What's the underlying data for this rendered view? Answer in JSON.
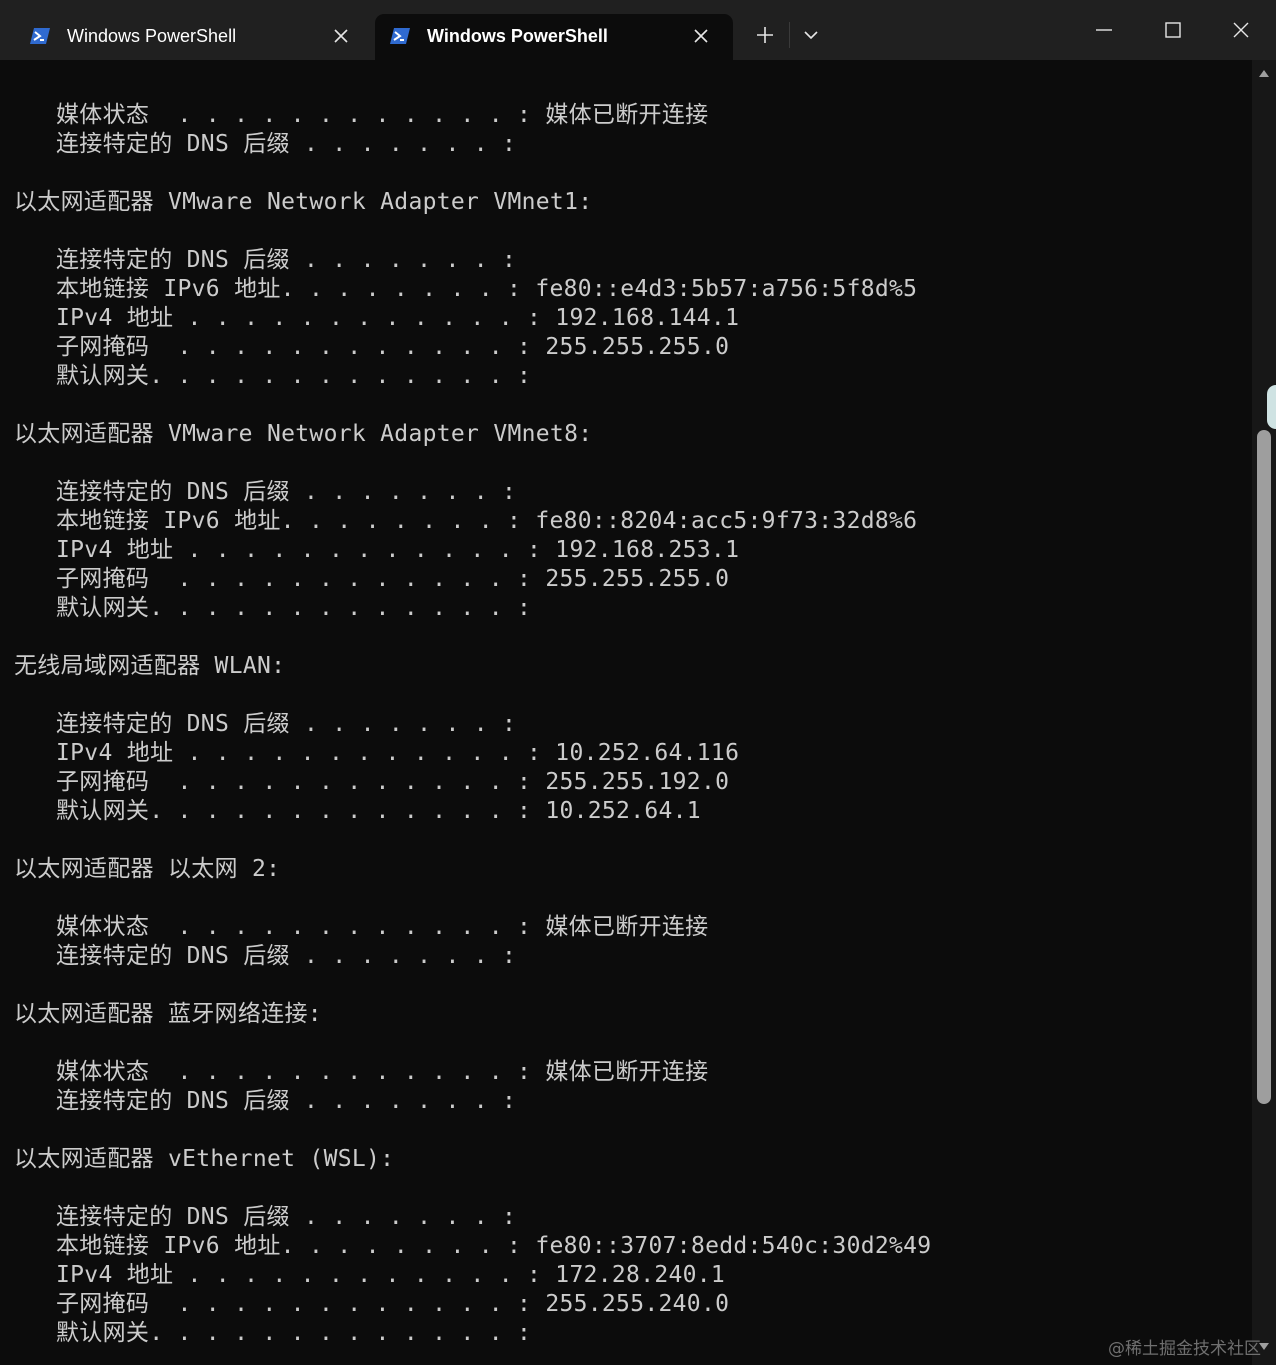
{
  "tabs": [
    {
      "title": "Windows PowerShell",
      "active": false
    },
    {
      "title": "Windows PowerShell",
      "active": true
    }
  ],
  "colors": {
    "titlebar": "#202020",
    "terminal_bg": "#0c0c0c",
    "text": "#cccccc",
    "powershell_icon": "#2f6ad0"
  },
  "terminal": {
    "lines": [
      "媒体状态  . . . . . . . . . . . . : 媒体已断开连接",
      "连接特定的 DNS 后缀 . . . . . . . :",
      "以太网适配器 VMware Network Adapter VMnet1:",
      "连接特定的 DNS 后缀 . . . . . . . :",
      "本地链接 IPv6 地址. . . . . . . . : fe80::e4d3:5b57:a756:5f8d%5",
      "IPv4 地址 . . . . . . . . . . . . : 192.168.144.1",
      "子网掩码  . . . . . . . . . . . . : 255.255.255.0",
      "默认网关. . . . . . . . . . . . . :",
      "以太网适配器 VMware Network Adapter VMnet8:",
      "连接特定的 DNS 后缀 . . . . . . . :",
      "本地链接 IPv6 地址. . . . . . . . : fe80::8204:acc5:9f73:32d8%6",
      "IPv4 地址 . . . . . . . . . . . . : 192.168.253.1",
      "子网掩码  . . . . . . . . . . . . : 255.255.255.0",
      "默认网关. . . . . . . . . . . . . :",
      "无线局域网适配器 WLAN:",
      "连接特定的 DNS 后缀 . . . . . . . :",
      "IPv4 地址 . . . . . . . . . . . . : 10.252.64.116",
      "子网掩码  . . . . . . . . . . . . : 255.255.192.0",
      "默认网关. . . . . . . . . . . . . : 10.252.64.1",
      "以太网适配器 以太网 2:",
      "媒体状态  . . . . . . . . . . . . : 媒体已断开连接",
      "连接特定的 DNS 后缀 . . . . . . . :",
      "以太网适配器 蓝牙网络连接:",
      "媒体状态  . . . . . . . . . . . . : 媒体已断开连接",
      "连接特定的 DNS 后缀 . . . . . . . :",
      "以太网适配器 vEthernet (WSL):",
      "连接特定的 DNS 后缀 . . . . . . . :",
      "本地链接 IPv6 地址. . . . . . . . : fe80::3707:8edd:540c:30d2%49",
      "IPv4 地址 . . . . . . . . . . . . : 172.28.240.1",
      "子网掩码  . . . . . . . . . . . . : 255.255.240.0",
      "默认网关. . . . . . . . . . . . . :"
    ]
  },
  "watermark": "@稀土掘金技术社区"
}
